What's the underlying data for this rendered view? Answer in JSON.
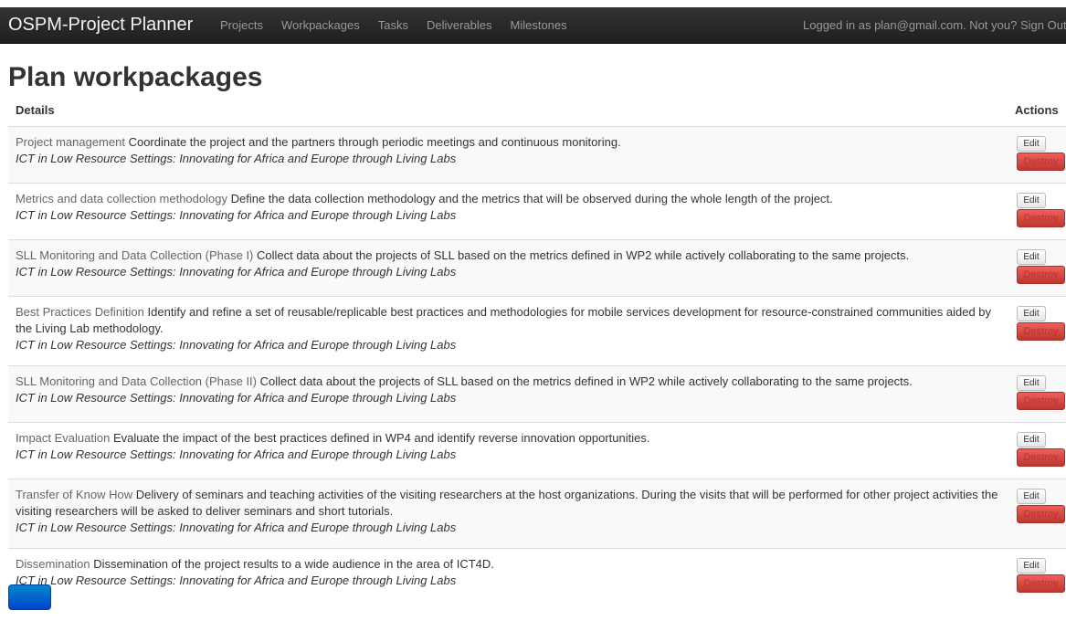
{
  "navbar": {
    "brand": "OSPM-Project Planner",
    "links": [
      "Projects",
      "Workpackages",
      "Tasks",
      "Deliverables",
      "Milestones"
    ],
    "login_text": "Logged in as plan@gmail.com. Not you?",
    "signout_label": "Sign Out"
  },
  "page": {
    "title": "Plan workpackages",
    "columns": {
      "details": "Details",
      "actions": "Actions"
    },
    "edit_label": "Edit",
    "destroy_label": "Destroy",
    "new_label": "New"
  },
  "workpackages": [
    {
      "name": "Project management",
      "description": "Coordinate the project and the partners through periodic meetings and continuous monitoring.",
      "project": "ICT in Low Resource Settings: Innovating for Africa and Europe through Living Labs"
    },
    {
      "name": "Metrics and data collection methodology",
      "description": "Define the data collection methodology and the metrics that will be observed during the whole length of the project.",
      "project": "ICT in Low Resource Settings: Innovating for Africa and Europe through Living Labs"
    },
    {
      "name": "SLL Monitoring and Data Collection (Phase I)",
      "description": "Collect data about the projects of SLL based on the metrics defined in WP2 while actively collaborating to the same projects.",
      "project": "ICT in Low Resource Settings: Innovating for Africa and Europe through Living Labs"
    },
    {
      "name": "Best Practices Definition",
      "description": "Identify and refine a set of reusable/replicable best practices and methodologies for mobile services development for resource-constrained communities aided by the Living Lab methodology.",
      "project": "ICT in Low Resource Settings: Innovating for Africa and Europe through Living Labs"
    },
    {
      "name": "SLL Monitoring and Data Collection (Phase II)",
      "description": "Collect data about the projects of SLL based on the metrics defined in WP2 while actively collaborating to the same projects.",
      "project": "ICT in Low Resource Settings: Innovating for Africa and Europe through Living Labs"
    },
    {
      "name": "Impact Evaluation",
      "description": "Evaluate the impact of the best practices defined in WP4 and identify reverse innovation opportunities.",
      "project": "ICT in Low Resource Settings: Innovating for Africa and Europe through Living Labs"
    },
    {
      "name": "Transfer of Know How",
      "description": "Delivery of seminars and teaching activities of the visiting researchers at the host organizations. During the visits that will be performed for other project activities the visiting researchers will be asked to deliver seminars and short tutorials.",
      "project": "ICT in Low Resource Settings: Innovating for Africa and Europe through Living Labs"
    },
    {
      "name": "Dissemination",
      "description": "Dissemination of the project results to a wide audience in the area of ICT4D.",
      "project": "ICT in Low Resource Settings: Innovating for Africa and Europe through Living Labs"
    }
  ]
}
